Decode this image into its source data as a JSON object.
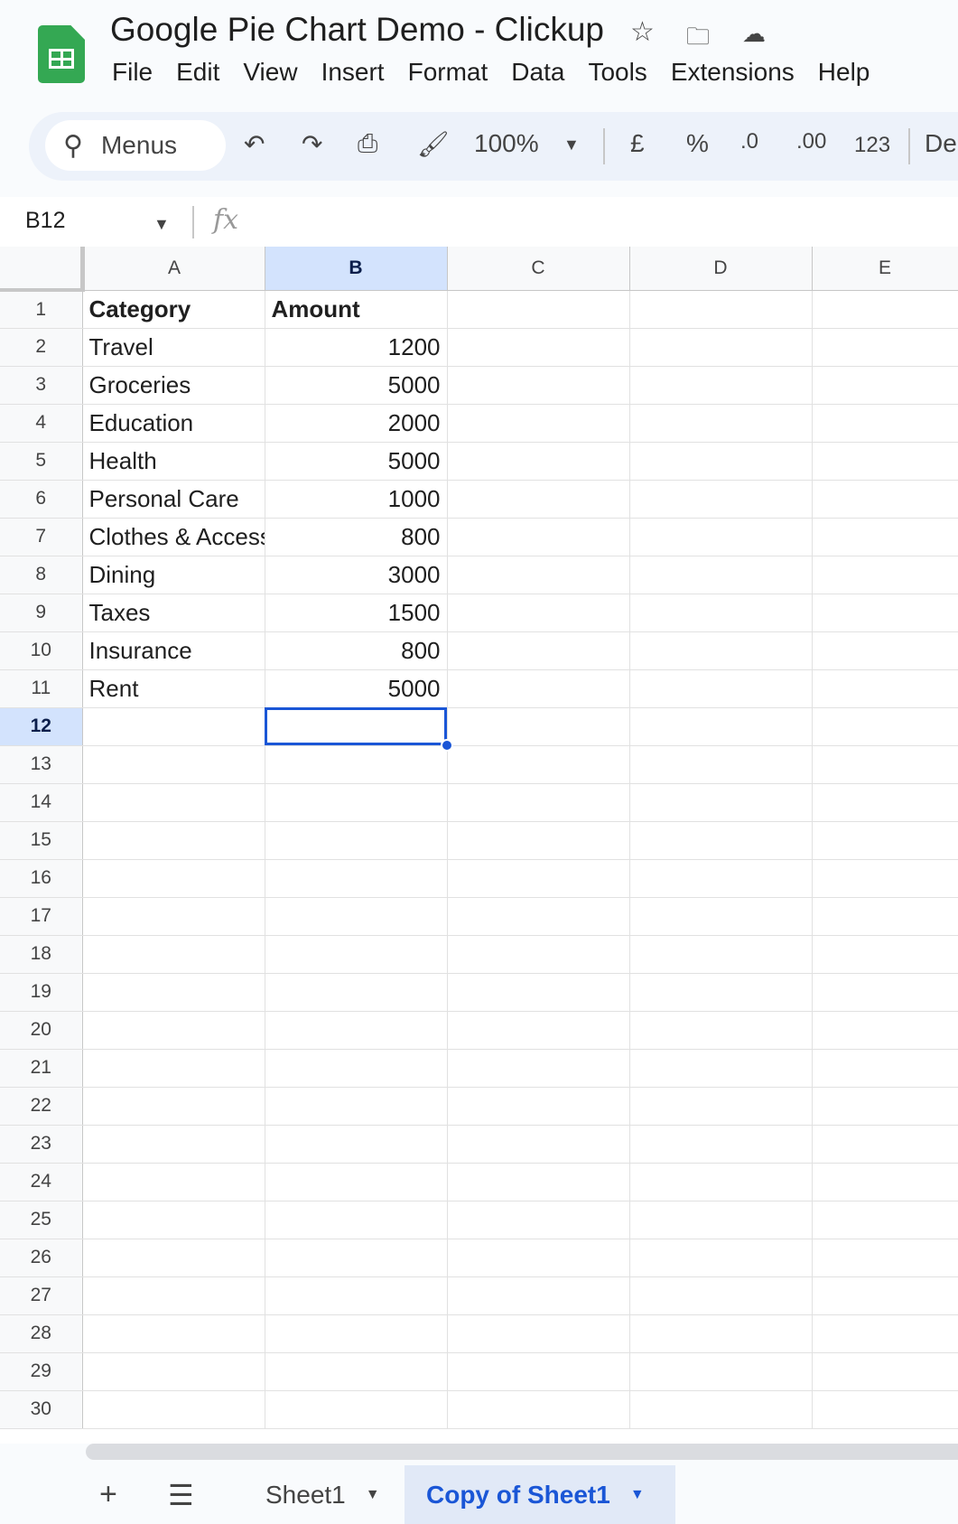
{
  "app": {
    "title": "Google Pie Chart Demo - Clickup",
    "menus": [
      "File",
      "Edit",
      "View",
      "Insert",
      "Format",
      "Data",
      "Tools",
      "Extensions",
      "Help"
    ]
  },
  "toolbar": {
    "search_label": "Menus",
    "zoom": "100%",
    "currency": "£",
    "percent": "%",
    "dec_decrease": ".0",
    "dec_increase": ".00",
    "number_format": "123",
    "font_partial": "De"
  },
  "formula_bar": {
    "name_box": "B12",
    "fx": "fx",
    "value": ""
  },
  "grid": {
    "columns": [
      "A",
      "B",
      "C",
      "D",
      "E"
    ],
    "selected_column": "B",
    "selected_row": 12,
    "active_cell": "B12",
    "rows": [
      [
        "Category",
        "Amount"
      ],
      [
        "Travel",
        "1200"
      ],
      [
        "Groceries",
        "5000"
      ],
      [
        "Education",
        "2000"
      ],
      [
        "Health",
        "5000"
      ],
      [
        "Personal Care",
        "1000"
      ],
      [
        "Clothes & Accessories",
        "800"
      ],
      [
        "Dining",
        "3000"
      ],
      [
        "Taxes",
        "1500"
      ],
      [
        "Insurance",
        "800"
      ],
      [
        "Rent",
        "5000"
      ]
    ],
    "row_count": 30
  },
  "sheets": {
    "tabs": [
      "Sheet1",
      "Copy of Sheet1"
    ],
    "active": "Copy of Sheet1"
  }
}
